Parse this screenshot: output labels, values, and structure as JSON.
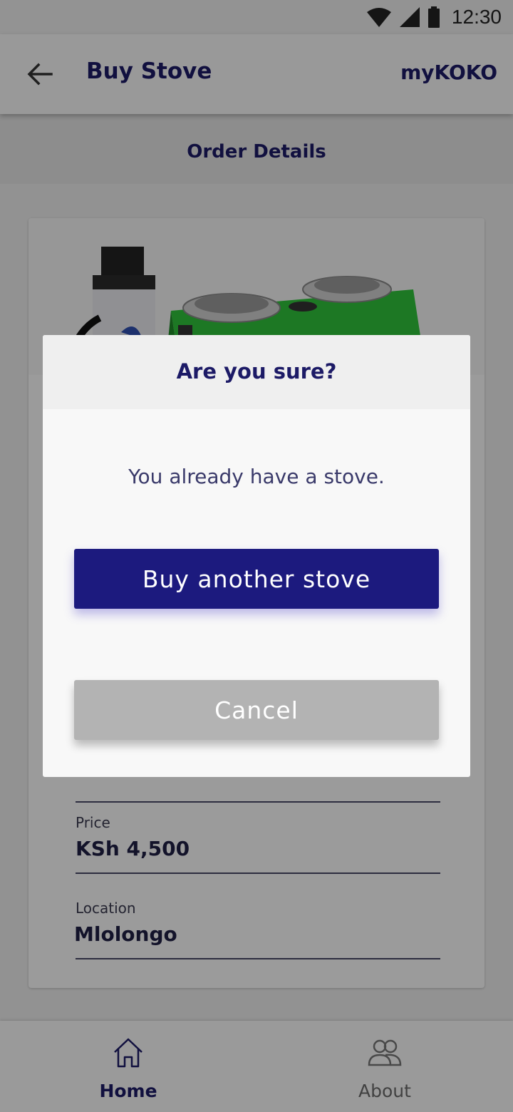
{
  "status_bar": {
    "time": "12:30"
  },
  "app_bar": {
    "title": "Buy Stove",
    "brand": "myKOKO"
  },
  "section": {
    "title": "Order Details"
  },
  "order": {
    "fields": [
      {
        "label": "Price",
        "value": "KSh 4,500"
      },
      {
        "label": "Location",
        "value": "Mlolongo"
      }
    ]
  },
  "bottom_nav": {
    "items": [
      {
        "label": "Home",
        "active": true
      },
      {
        "label": "About",
        "active": false
      }
    ]
  },
  "dialog": {
    "title": "Are you sure?",
    "message": "You already have a stove.",
    "primary_label": "Buy another stove",
    "secondary_label": "Cancel"
  },
  "colors": {
    "brand": "#1c1a66",
    "primary_button": "#1c1a7e",
    "secondary_button": "#b3b3b3",
    "stove_green": "#2fc23a"
  }
}
